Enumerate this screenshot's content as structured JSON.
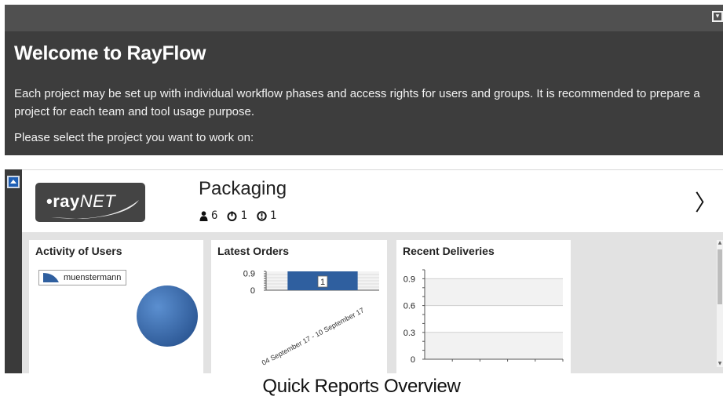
{
  "welcome": {
    "title": "Welcome to RayFlow",
    "description": "Each project may be set up with individual workflow phases and access rights for users and groups. It is recommended to prepare a project for each team and tool usage purpose.",
    "prompt": "Please select the project you want to work on:"
  },
  "project": {
    "logo_main": "•ray",
    "logo_sub": "NET",
    "name": "Packaging",
    "stats": {
      "users": "6",
      "pending": "1",
      "alerts": "1"
    }
  },
  "reports": {
    "activity": {
      "title": "Activity of Users",
      "legend": "muenstermann"
    },
    "orders": {
      "title": "Latest Orders"
    },
    "deliveries": {
      "title": "Recent Deliveries"
    }
  },
  "caption": "Quick Reports Overview",
  "colors": {
    "chart_blue": "#2f5f9f",
    "header_dark": "#3d3d3d",
    "button_blue": "#1f5fb5"
  },
  "chart_data": [
    {
      "type": "pie",
      "title": "Activity of Users",
      "categories": [
        "muenstermann"
      ],
      "values": [
        1
      ]
    },
    {
      "type": "bar",
      "title": "Latest Orders",
      "categories": [
        "04 September 17 - 10 September 17"
      ],
      "values": [
        1
      ],
      "data_labels": [
        "1"
      ],
      "ytick_labels": [
        "0",
        "0.9"
      ],
      "ylim": [
        0,
        1
      ]
    },
    {
      "type": "line",
      "title": "Recent Deliveries",
      "categories": [],
      "values": [],
      "ytick_labels": [
        "0",
        "0.3",
        "0.6",
        "0.9"
      ],
      "ylim": [
        0,
        1
      ]
    }
  ]
}
